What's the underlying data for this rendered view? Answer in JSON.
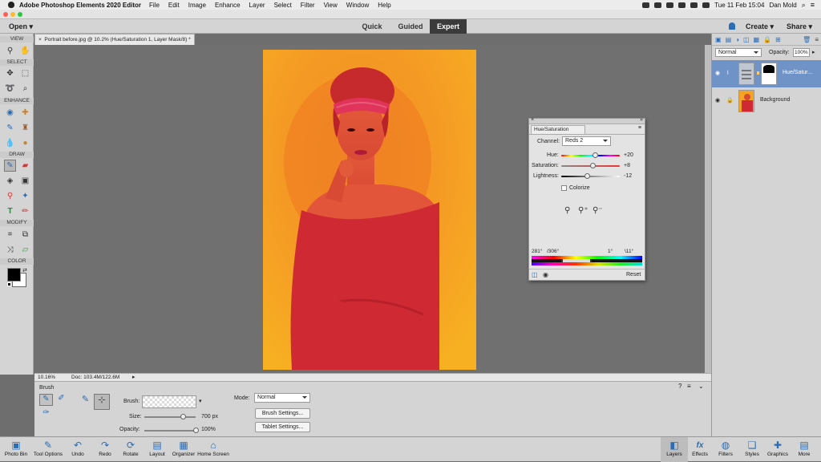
{
  "menubar": {
    "app_name": "Adobe Photoshop Elements 2020 Editor",
    "items": [
      "File",
      "Edit",
      "Image",
      "Enhance",
      "Layer",
      "Select",
      "Filter",
      "View",
      "Window",
      "Help"
    ],
    "clock": "Tue 11 Feb  15:04",
    "user": "Dan Mold"
  },
  "modebar": {
    "open_label": "Open",
    "tabs": [
      {
        "label": "Quick"
      },
      {
        "label": "Guided"
      },
      {
        "label": "Expert"
      }
    ],
    "create_label": "Create",
    "share_label": "Share"
  },
  "toolbox": {
    "sections": {
      "view": "VIEW",
      "select": "SELECT",
      "enhance": "ENHANCE",
      "draw": "DRAW",
      "modify": "MODIFY",
      "color": "COLOR"
    }
  },
  "document": {
    "tab_label": "Portrait before.jpg @ 10.2% (Hue/Saturation 1, Layer Mask/8) *",
    "zoom": "10.16%",
    "doc_size": "Doc: 103.4M/122.6M"
  },
  "tool_options": {
    "tool_name": "Brush",
    "brush_label": "Brush:",
    "size_label": "Size:",
    "size_value": "700 px",
    "size_fraction": 0.75,
    "opacity_label": "Opacity:",
    "opacity_value": "100%",
    "opacity_fraction": 1.0,
    "mode_label": "Mode:",
    "mode_value": "Normal",
    "brush_settings_label": "Brush Settings...",
    "tablet_settings_label": "Tablet Settings..."
  },
  "bottombar": {
    "left": [
      {
        "label": "Photo Bin",
        "icon": "photo-bin-icon"
      },
      {
        "label": "Tool Options",
        "icon": "tool-options-icon"
      },
      {
        "label": "Undo",
        "icon": "undo-icon"
      },
      {
        "label": "Redo",
        "icon": "redo-icon"
      },
      {
        "label": "Rotate",
        "icon": "rotate-icon"
      },
      {
        "label": "Layout",
        "icon": "layout-icon"
      },
      {
        "label": "Organizer",
        "icon": "organizer-icon"
      },
      {
        "label": "Home Screen",
        "icon": "home-icon"
      }
    ],
    "right": [
      {
        "label": "Layers",
        "icon": "layers-icon"
      },
      {
        "label": "Effects",
        "icon": "effects-icon"
      },
      {
        "label": "Filters",
        "icon": "filters-icon"
      },
      {
        "label": "Styles",
        "icon": "styles-icon"
      },
      {
        "label": "Graphics",
        "icon": "graphics-icon"
      },
      {
        "label": "More",
        "icon": "more-icon"
      }
    ]
  },
  "layers_panel": {
    "blend_mode": "Normal",
    "opacity_label": "Opacity:",
    "opacity_value": "100%",
    "layers": [
      {
        "name": "Hue/Satur...",
        "selected": true
      },
      {
        "name": "Background",
        "selected": false
      }
    ]
  },
  "hue_saturation": {
    "title": "Hue/Saturation",
    "channel_label": "Channel:",
    "channel_value": "Reds 2",
    "hue_label": "Hue:",
    "hue_value": "+20",
    "hue_fraction": 0.58,
    "saturation_label": "Saturation:",
    "saturation_value": "+8",
    "saturation_fraction": 0.54,
    "lightness_label": "Lightness:",
    "lightness_value": "-12",
    "lightness_fraction": 0.44,
    "colorize_label": "Colorize",
    "colorize_checked": false,
    "range_left": "281°",
    "range_left2": "/306°",
    "range_right": "1°",
    "range_right2": "\\11°",
    "reset_label": "Reset"
  },
  "colors": {
    "accent": "#2a6db5",
    "selected_layer": "#6f93c6",
    "photo_bg": "#f6a61f",
    "dress": "#cf2a33"
  }
}
